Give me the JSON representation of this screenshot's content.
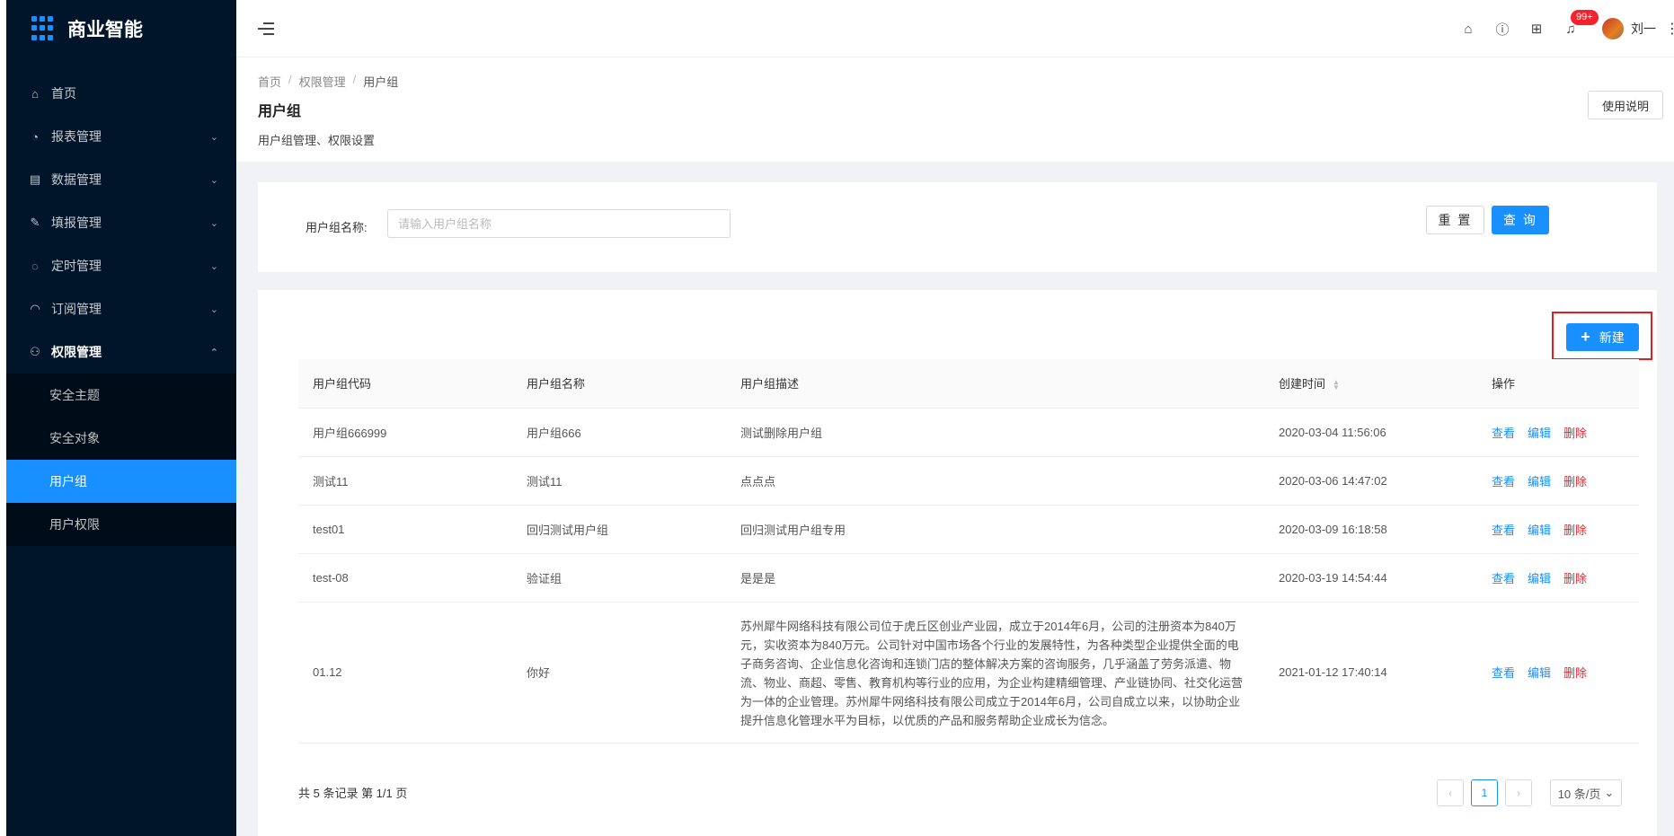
{
  "app": {
    "title": "商业智能"
  },
  "sidebar": {
    "items": [
      {
        "icon": "home-icon",
        "glyph": "⌂",
        "label": "首页",
        "has_children": false
      },
      {
        "icon": "dashboard-icon",
        "glyph": "◔",
        "label": "报表管理",
        "has_children": true
      },
      {
        "icon": "database-icon",
        "glyph": "▤",
        "label": "数据管理",
        "has_children": true
      },
      {
        "icon": "edit-icon",
        "glyph": "✎",
        "label": "填报管理",
        "has_children": true
      },
      {
        "icon": "bell-icon",
        "glyph": "◌",
        "label": "定时管理",
        "has_children": true
      },
      {
        "icon": "wifi-icon",
        "glyph": "◠",
        "label": "订阅管理",
        "has_children": true
      },
      {
        "icon": "user-icon",
        "glyph": "⚇",
        "label": "权限管理",
        "has_children": true,
        "open": true
      }
    ],
    "sub_items": [
      {
        "label": "安全主题"
      },
      {
        "label": "安全对象"
      },
      {
        "label": "用户组",
        "active": true
      },
      {
        "label": "用户权限"
      }
    ]
  },
  "header": {
    "notification_count": "99+",
    "username": "刘一"
  },
  "breadcrumb": [
    "首页",
    "权限管理",
    "用户组"
  ],
  "page": {
    "title": "用户组",
    "subtitle": "用户组管理、权限设置",
    "help_label": "使用说明"
  },
  "search": {
    "label": "用户组名称:",
    "placeholder": "请输入用户组名称",
    "value": "",
    "reset_label": "重 置",
    "query_label": "查 询"
  },
  "toolbar": {
    "new_label": "新建"
  },
  "table": {
    "columns": [
      "用户组代码",
      "用户组名称",
      "用户组描述",
      "创建时间",
      "操作"
    ],
    "actions": {
      "view": "查看",
      "edit": "编辑",
      "delete": "删除"
    },
    "rows": [
      {
        "code": "用户组666999",
        "name": "用户组666",
        "desc": "测试删除用户组",
        "created": "2020-03-04 11:56:06"
      },
      {
        "code": "测试11",
        "name": "测试11",
        "desc": "点点点",
        "created": "2020-03-06 14:47:02"
      },
      {
        "code": "test01",
        "name": "回归测试用户组",
        "desc": "回归测试用户组专用",
        "created": "2020-03-09 16:18:58"
      },
      {
        "code": "test-08",
        "name": "验证组",
        "desc": "是是是",
        "created": "2020-03-19 14:54:44"
      },
      {
        "code": "01.12",
        "name": "你好",
        "desc": "苏州犀牛网络科技有限公司位于虎丘区创业产业园，成立于2014年6月，公司的注册资本为840万元，实收资本为840万元。公司针对中国市场各个行业的发展特性，为各种类型企业提供全面的电子商务咨询、企业信息化咨询和连锁门店的整体解决方案的咨询服务，几乎涵盖了劳务派遣、物流、物业、商超、零售、教育机构等行业的应用，为企业构建精细管理、产业链协同、社交化运营为一体的企业管理。苏州犀牛网络科技有限公司成立于2014年6月，公司自成立以来，以协助企业提升信息化管理水平为目标，以优质的产品和服务帮助企业成长为信念。",
        "created": "2021-01-12 17:40:14"
      }
    ]
  },
  "pagination": {
    "summary": "共 5 条记录 第 1/1 页",
    "current_page": "1",
    "page_size": "10 条/页"
  }
}
